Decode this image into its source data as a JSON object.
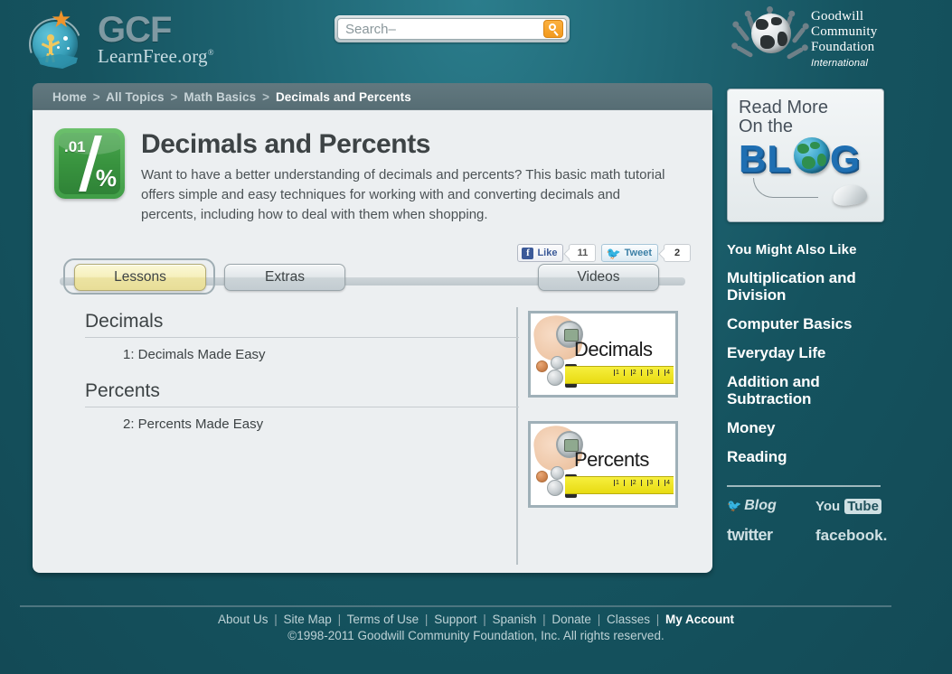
{
  "header": {
    "logo": {
      "gcf": "GCF",
      "learnfree": "LearnFree.org",
      "registered": "®"
    },
    "search": {
      "placeholder": "Search–",
      "value": "",
      "button_icon": "search-icon"
    },
    "gcfi": {
      "line1": "Goodwill",
      "line2": "Community",
      "line3": "Foundation",
      "line4": "International"
    }
  },
  "breadcrumb": {
    "items": [
      "Home",
      "All Topics",
      "Math Basics"
    ],
    "separator": ">",
    "current": "Decimals and Percents"
  },
  "main": {
    "title": "Decimals and Percents",
    "description": "Want to have a better understanding of decimals and percents? This basic math tutorial offers simple and easy techniques for working with and converting decimals and percents, including how to deal with them when shopping.",
    "icon": {
      "decimal_text": ".01",
      "percent_text": "%"
    },
    "social": {
      "facebook_label": "Like",
      "facebook_count": "11",
      "facebook_icon": "facebook-f-icon",
      "twitter_label": "Tweet",
      "twitter_count": "2",
      "twitter_icon": "twitter-bird-icon"
    },
    "tabs": [
      {
        "label": "Lessons",
        "active": true
      },
      {
        "label": "Extras",
        "active": false
      },
      {
        "label": "Videos",
        "active": false
      }
    ],
    "lesson_groups": [
      {
        "title": "Decimals",
        "items": [
          "1: Decimals Made Easy"
        ]
      },
      {
        "title": "Percents",
        "items": [
          "2: Percents Made Easy"
        ]
      }
    ],
    "thumbnails": [
      {
        "label": "Decimals"
      },
      {
        "label": "Percents"
      }
    ]
  },
  "sidebar": {
    "blog_box": {
      "line1": "Read More",
      "line2": "On the",
      "blog_word_left": "BL",
      "blog_word_right": "G"
    },
    "also_like_title": "You Might Also Like",
    "also_like_items": [
      "Multiplication and Division",
      "Computer Basics",
      "Everyday Life",
      "Addition and Subtraction",
      "Money",
      "Reading"
    ],
    "social": {
      "blog": "Blog",
      "youtube_you": "You",
      "youtube_tube": "Tube",
      "twitter": "twitter",
      "facebook": "facebook."
    }
  },
  "footer": {
    "links": [
      "About Us",
      "Site Map",
      "Terms of Use",
      "Support",
      "Spanish",
      "Donate",
      "Classes"
    ],
    "separator": "|",
    "account_link": "My Account",
    "copyright": "©1998-2011 Goodwill Community Foundation, Inc. All rights reserved."
  },
  "colors": {
    "background_teal": "#15535f",
    "breadcrumb_bar": "#5a7178",
    "panel": "#eceff1",
    "active_tab": "#f2ebb4",
    "accent_orange": "#f29a1e",
    "icon_green": "#3f9d46"
  }
}
